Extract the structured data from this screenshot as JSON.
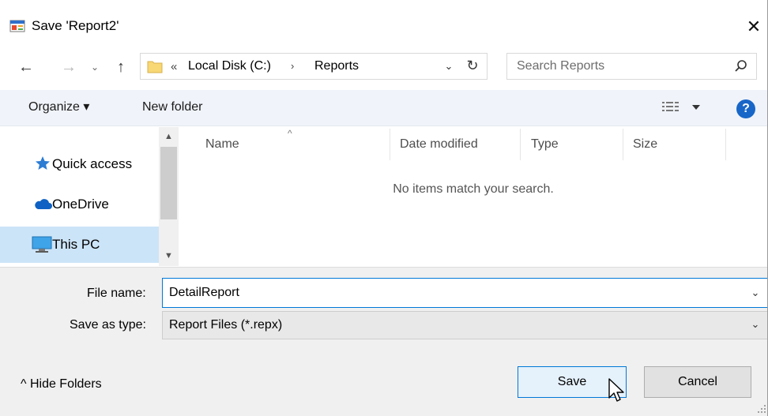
{
  "window": {
    "title": "Save 'Report2'",
    "close_glyph": "✕",
    "icon": "report-app-icon"
  },
  "nav": {
    "back_glyph": "←",
    "forward_glyph": "→",
    "recent_glyph": "⌄",
    "up_glyph": "↑"
  },
  "address": {
    "overflow": "«",
    "crumbs": [
      "Local Disk (C:)",
      "Reports"
    ],
    "separator": "›",
    "dropdown_glyph": "⌄",
    "refresh_glyph": "↻"
  },
  "search": {
    "placeholder": "Search Reports"
  },
  "toolbar": {
    "organize": "Organize ▾",
    "new_folder": "New folder",
    "help": "?"
  },
  "sidebar": {
    "items": [
      {
        "label": "Quick access",
        "icon": "star-icon"
      },
      {
        "label": "OneDrive",
        "icon": "cloud-icon"
      },
      {
        "label": "This PC",
        "icon": "computer-icon",
        "selected": true
      }
    ],
    "scroll_up": "▲",
    "scroll_down": "▼"
  },
  "filelist": {
    "columns": [
      "Name",
      "Date modified",
      "Type",
      "Size"
    ],
    "sort_glyph": "^",
    "empty_message": "No items match your search."
  },
  "form": {
    "filename_label": "File name:",
    "filename_value": "DetailReport",
    "type_label": "Save as type:",
    "type_value": "Report Files (*.repx)",
    "dropdown_glyph": "⌄"
  },
  "footer": {
    "hide_folders": "^  Hide Folders",
    "save": "Save",
    "cancel": "Cancel"
  },
  "colors": {
    "accent": "#0078d7",
    "help_blue": "#1866c7",
    "selected_bg": "#cce4f7",
    "cmdbar_bg": "#f0f3f9",
    "folder_yellow": "#f8d775"
  }
}
